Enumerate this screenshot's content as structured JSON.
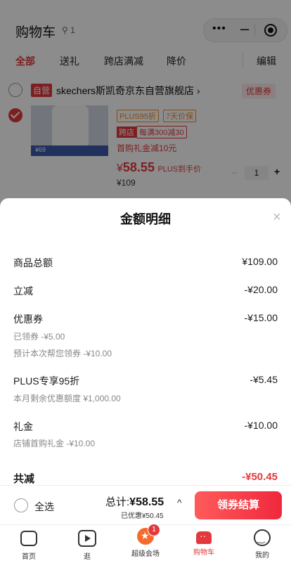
{
  "header": {
    "title": "购物车",
    "location": "1"
  },
  "tabs": [
    {
      "label": "全部",
      "active": true
    },
    {
      "label": "送礼"
    },
    {
      "label": "跨店满减"
    },
    {
      "label": "降价"
    }
  ],
  "edit_label": "编辑",
  "shop": {
    "self_tag": "自营",
    "name": "skechers斯凯奇京东自营旗舰店",
    "arrow": "›",
    "coupon_button": "优惠券"
  },
  "product": {
    "tags": [
      "PLUS95折",
      "7天价保"
    ],
    "cross_store_tag": "跨店",
    "cross_store_text": "每满300减30",
    "first_gift": "首购礼金减10元",
    "price_symbol": "¥",
    "price": "58.55",
    "price_note": "PLUS到手价",
    "original_price": "¥109",
    "qty": "1",
    "thumb_price": "69"
  },
  "sheet": {
    "title": "金额明细",
    "close": "×",
    "lines": [
      {
        "label": "商品总额",
        "value": "¥109.00"
      },
      {
        "label": "立减",
        "value": "-¥20.00"
      },
      {
        "label": "优惠券",
        "value": "-¥15.00",
        "subs": [
          "已领券 -¥5.00",
          "预计本次帮您领券 -¥10.00"
        ]
      },
      {
        "label": "PLUS专享95折",
        "value": "-¥5.45",
        "subs": [
          "本月剩余优惠额度 ¥1,000.00"
        ]
      },
      {
        "label": "礼金",
        "value": "-¥10.00",
        "subs": [
          "店铺首购礼金 -¥10.00"
        ]
      }
    ],
    "total": {
      "label": "共减",
      "value": "-¥50.45"
    }
  },
  "bottom_bar": {
    "select_all": "全选",
    "total_label": "总计:",
    "total_value": "¥58.55",
    "saved": "已优惠¥50.45",
    "caret": "^",
    "checkout": "领券结算"
  },
  "tabbar": [
    {
      "label": "首页",
      "icon": "home-icon"
    },
    {
      "label": "逛",
      "icon": "play-icon"
    },
    {
      "label": "超级会场",
      "icon": "vip-icon",
      "badge": "1"
    },
    {
      "label": "购物车",
      "icon": "cart-icon",
      "active": true
    },
    {
      "label": "我的",
      "icon": "profile-icon"
    }
  ],
  "colors": {
    "accent": "#e4393c",
    "checkout_gradient_start": "#ff5b5b",
    "checkout_gradient_end": "#f0283c"
  }
}
